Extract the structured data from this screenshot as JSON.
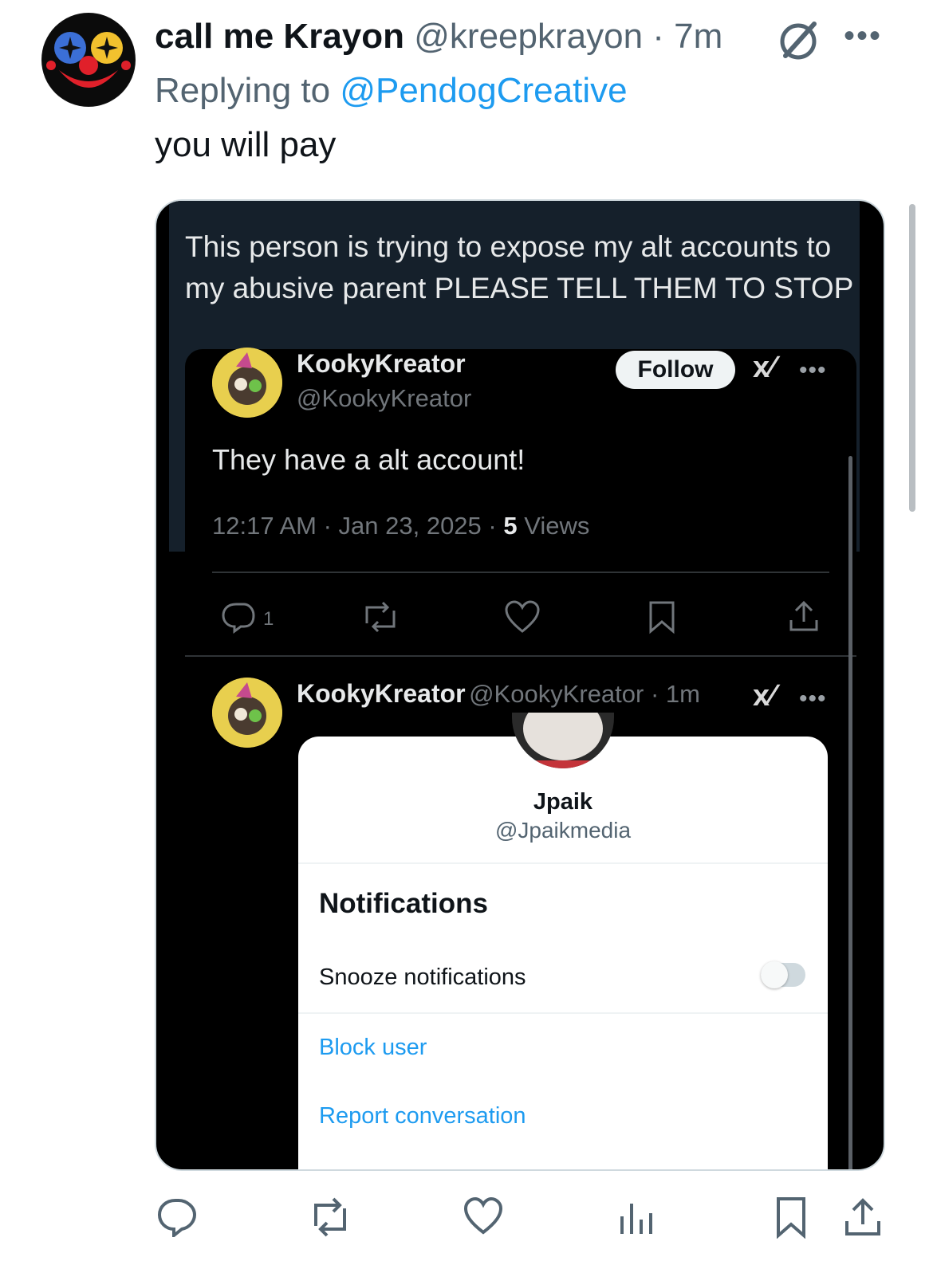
{
  "tweet": {
    "display_name": "call me Krayon",
    "handle_time": "@kreepkrayon · 7m",
    "replying_prefix": "Replying to",
    "replying_to": "@PendogCreative",
    "text": "you will pay"
  },
  "screenshot": {
    "caption": "This person is trying to expose my alt accounts to my abusive parent PLEASE TELL THEM TO STOP",
    "post1": {
      "name": "KookyKreator",
      "handle": "@KookyKreator",
      "follow_label": "Follow",
      "text": "They have a alt account!",
      "timestamp": "12:17 AM · Jan 23, 2025 · ",
      "views_count": "5",
      "views_label": " Views",
      "reply_count": "1"
    },
    "post2": {
      "name": "KookyKreator",
      "handle_time": "@KookyKreator · 1m"
    },
    "sheet": {
      "name": "Jpaik",
      "handle": "@Jpaikmedia",
      "section_title": "Notifications",
      "snooze_label": "Snooze notifications",
      "snooze_on": false,
      "block_label": "Block user",
      "report_label": "Report conversation"
    }
  },
  "colors": {
    "link": "#1d9bf0",
    "secondary_text": "#536471",
    "dark_bg": "#15202b"
  },
  "icons": [
    "grok-icon",
    "more-icon",
    "reply-icon",
    "retweet-icon",
    "like-icon",
    "views-icon",
    "bookmark-icon",
    "share-icon"
  ]
}
